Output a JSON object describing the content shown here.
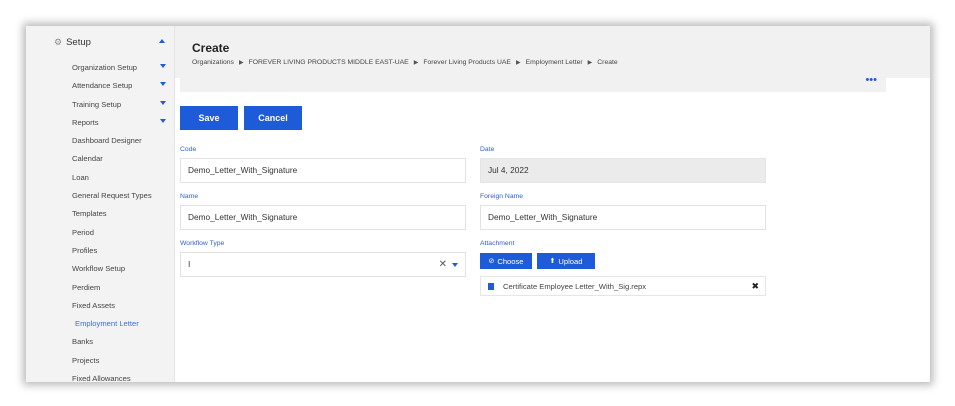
{
  "sidebar": {
    "section_title": "Setup",
    "items": [
      {
        "label": "Organization Setup",
        "has_caret": true
      },
      {
        "label": "Attendance Setup",
        "has_caret": true
      },
      {
        "label": "Training Setup",
        "has_caret": true
      },
      {
        "label": "Reports",
        "has_caret": true
      },
      {
        "label": "Dashboard Designer"
      },
      {
        "label": "Calendar"
      },
      {
        "label": "Loan"
      },
      {
        "label": "General Request Types"
      },
      {
        "label": "Templates"
      },
      {
        "label": "Period"
      },
      {
        "label": "Profiles"
      },
      {
        "label": "Workflow Setup"
      },
      {
        "label": "Perdiem"
      },
      {
        "label": "Fixed Assets"
      },
      {
        "label": "Employment Letter",
        "active": true
      },
      {
        "label": "Banks"
      },
      {
        "label": "Projects"
      },
      {
        "label": "Fixed Allowances"
      }
    ]
  },
  "header": {
    "title": "Create",
    "breadcrumb": [
      "Organizations",
      "FOREVER LIVING PRODUCTS MIDDLE EAST-UAE",
      "Forever Living Products UAE",
      "Employment Letter",
      "Create"
    ],
    "separator": "▶"
  },
  "toolbar": {
    "more_icon": "•••",
    "save_label": "Save",
    "cancel_label": "Cancel"
  },
  "form": {
    "code": {
      "label": "Code",
      "value": "Demo_Letter_With_Signature"
    },
    "date": {
      "label": "Date",
      "value": "Jul 4, 2022"
    },
    "name": {
      "label": "Name",
      "value": "Demo_Letter_With_Signature"
    },
    "foreign_name": {
      "label": "Foreign Name",
      "value": "Demo_Letter_With_Signature"
    },
    "workflow_type": {
      "label": "Workflow Type",
      "value": "I",
      "clear_icon": "✕"
    },
    "attachment": {
      "label": "Attachment",
      "choose_label": "Choose",
      "upload_label": "Upload",
      "file_name": "Certificate Employee Letter_With_Sig.repx",
      "remove_icon": "✖"
    }
  },
  "colors": {
    "primary": "#1e5bd8",
    "label": "#2a5fd6",
    "sidebar_bg": "#f3f3f3",
    "header_bg": "#f1f1f1"
  }
}
